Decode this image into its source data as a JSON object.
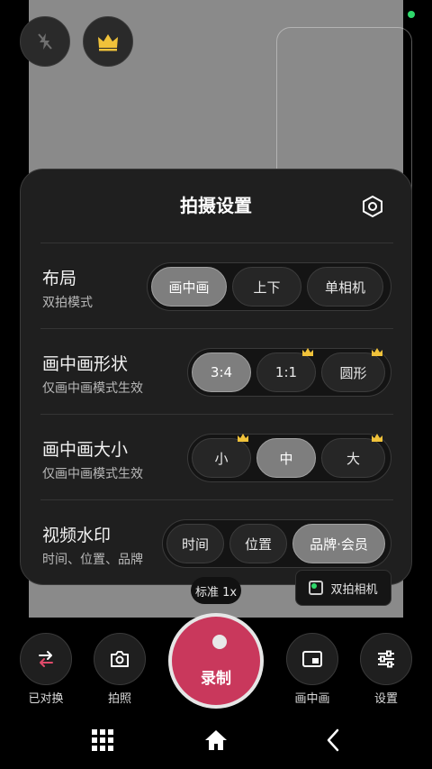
{
  "panel": {
    "title": "拍摄设置"
  },
  "rows": [
    {
      "title": "布局",
      "subtitle": "双拍模式",
      "options": [
        "画中画",
        "上下",
        "单相机"
      ],
      "selected": 0
    },
    {
      "title": "画中画形状",
      "subtitle": "仅画中画模式生效",
      "options": [
        "3:4",
        "1:1",
        "圆形"
      ],
      "selected": 0
    },
    {
      "title": "画中画大小",
      "subtitle": "仅画中画模式生效",
      "options": [
        "小",
        "中",
        "大"
      ],
      "selected": 1
    },
    {
      "title": "视频水印",
      "subtitle": "时间、位置、品牌",
      "options": [
        "时间",
        "位置",
        "品牌·会员"
      ],
      "selected": 2
    }
  ],
  "zoom_label": "标准 1x",
  "dual_camera_label": "双拍相机",
  "bottom": {
    "switch_label": "已对换",
    "photo_label": "拍照",
    "record_label": "录制",
    "pip_label": "画中画",
    "settings_label": "设置"
  },
  "colors": {
    "record": "#c9385c",
    "crown": "#f0c23a",
    "status_dot": "#2fd86b"
  },
  "icons": [
    "flash-off-icon",
    "crown-icon",
    "settings-hex-icon",
    "swap-icon",
    "camera-icon",
    "pip-icon",
    "sliders-icon",
    "grid-menu-icon",
    "home-icon",
    "back-icon"
  ]
}
